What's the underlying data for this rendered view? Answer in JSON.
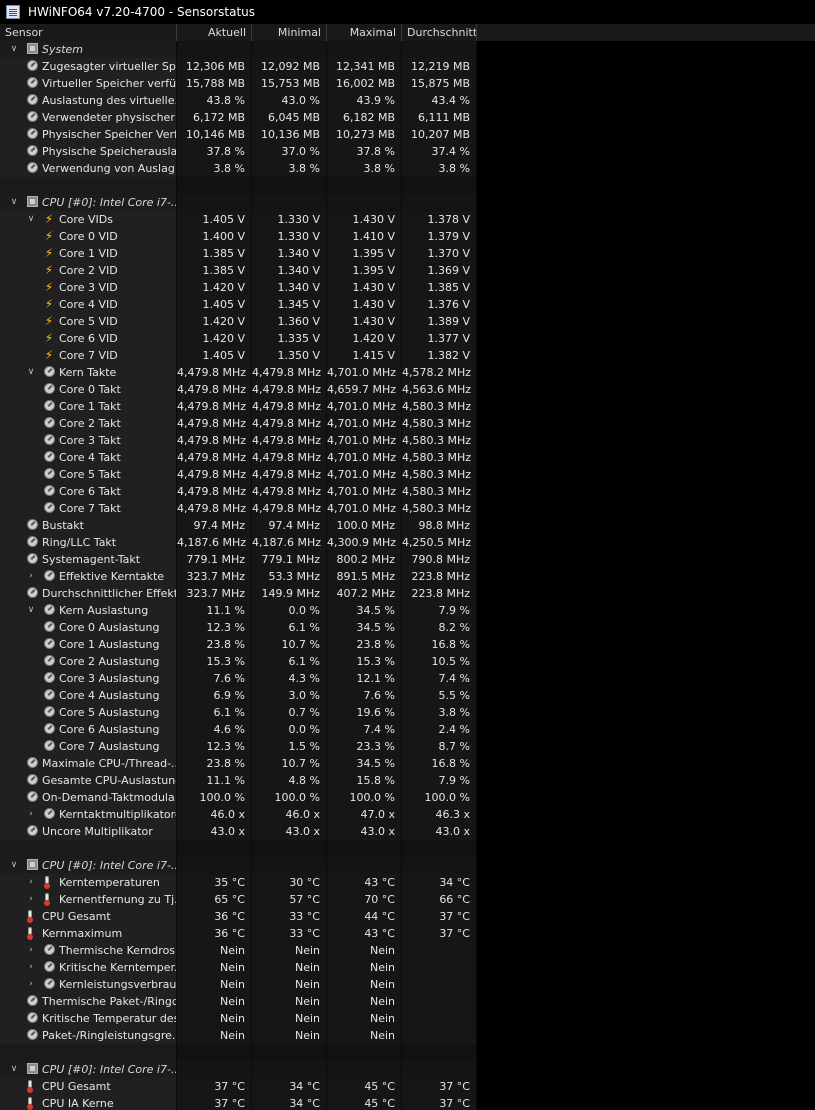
{
  "window": {
    "title": "HWiNFO64 v7.20-4700 - Sensorstatus"
  },
  "columns": [
    "Sensor",
    "Aktuell",
    "Minimal",
    "Maximal",
    "Durchschnitt"
  ],
  "rows": [
    {
      "t": "group",
      "exp": "v",
      "ind": 0,
      "icon": "chip",
      "label": "System"
    },
    {
      "t": "row",
      "exp": "",
      "ind": 1,
      "icon": "dial",
      "label": "Zugesagter virtueller Sp...",
      "v": [
        "12,306 MB",
        "12,092 MB",
        "12,341 MB",
        "12,219 MB"
      ]
    },
    {
      "t": "row",
      "exp": "",
      "ind": 1,
      "icon": "dial",
      "label": "Virtueller Speicher verfü...",
      "v": [
        "15,788 MB",
        "15,753 MB",
        "16,002 MB",
        "15,875 MB"
      ]
    },
    {
      "t": "row",
      "exp": "",
      "ind": 1,
      "icon": "dial",
      "label": "Auslastung des virtuelle...",
      "v": [
        "43.8 %",
        "43.0 %",
        "43.9 %",
        "43.4 %"
      ]
    },
    {
      "t": "row",
      "exp": "",
      "ind": 1,
      "icon": "dial",
      "label": "Verwendeter physischer ...",
      "v": [
        "6,172 MB",
        "6,045 MB",
        "6,182 MB",
        "6,111 MB"
      ]
    },
    {
      "t": "row",
      "exp": "",
      "ind": 1,
      "icon": "dial",
      "label": "Physischer Speicher Verf...",
      "v": [
        "10,146 MB",
        "10,136 MB",
        "10,273 MB",
        "10,207 MB"
      ]
    },
    {
      "t": "row",
      "exp": "",
      "ind": 1,
      "icon": "dial",
      "label": "Physische Speicherausla...",
      "v": [
        "37.8 %",
        "37.0 %",
        "37.8 %",
        "37.4 %"
      ]
    },
    {
      "t": "row",
      "exp": "",
      "ind": 1,
      "icon": "dial",
      "label": "Verwendung von Auslag...",
      "v": [
        "3.8 %",
        "3.8 %",
        "3.8 %",
        "3.8 %"
      ]
    },
    {
      "t": "empty"
    },
    {
      "t": "group",
      "exp": "v",
      "ind": 0,
      "icon": "chip",
      "label": "CPU [#0]: Intel Core i7-..."
    },
    {
      "t": "row",
      "exp": "v",
      "ind": 2,
      "icon": "bolt",
      "label": "Core VIDs",
      "v": [
        "1.405 V",
        "1.330 V",
        "1.430 V",
        "1.378 V"
      ]
    },
    {
      "t": "row",
      "exp": "",
      "ind": 2,
      "icon": "bolt",
      "label": "Core 0 VID",
      "v": [
        "1.400 V",
        "1.330 V",
        "1.410 V",
        "1.379 V"
      ]
    },
    {
      "t": "row",
      "exp": "",
      "ind": 2,
      "icon": "bolt",
      "label": "Core 1 VID",
      "v": [
        "1.385 V",
        "1.340 V",
        "1.395 V",
        "1.370 V"
      ]
    },
    {
      "t": "row",
      "exp": "",
      "ind": 2,
      "icon": "bolt",
      "label": "Core 2 VID",
      "v": [
        "1.385 V",
        "1.340 V",
        "1.395 V",
        "1.369 V"
      ]
    },
    {
      "t": "row",
      "exp": "",
      "ind": 2,
      "icon": "bolt",
      "label": "Core 3 VID",
      "v": [
        "1.420 V",
        "1.340 V",
        "1.430 V",
        "1.385 V"
      ]
    },
    {
      "t": "row",
      "exp": "",
      "ind": 2,
      "icon": "bolt",
      "label": "Core 4 VID",
      "v": [
        "1.405 V",
        "1.345 V",
        "1.430 V",
        "1.376 V"
      ]
    },
    {
      "t": "row",
      "exp": "",
      "ind": 2,
      "icon": "bolt",
      "label": "Core 5 VID",
      "v": [
        "1.420 V",
        "1.360 V",
        "1.430 V",
        "1.389 V"
      ]
    },
    {
      "t": "row",
      "exp": "",
      "ind": 2,
      "icon": "bolt",
      "label": "Core 6 VID",
      "v": [
        "1.420 V",
        "1.335 V",
        "1.420 V",
        "1.377 V"
      ]
    },
    {
      "t": "row",
      "exp": "",
      "ind": 2,
      "icon": "bolt",
      "label": "Core 7 VID",
      "v": [
        "1.405 V",
        "1.350 V",
        "1.415 V",
        "1.382 V"
      ]
    },
    {
      "t": "row",
      "exp": "v",
      "ind": 2,
      "icon": "dial",
      "label": "Kern Takte",
      "v": [
        "4,479.8 MHz",
        "4,479.8 MHz",
        "4,701.0 MHz",
        "4,578.2 MHz"
      ]
    },
    {
      "t": "row",
      "exp": "",
      "ind": 2,
      "icon": "dial",
      "label": "Core 0 Takt",
      "v": [
        "4,479.8 MHz",
        "4,479.8 MHz",
        "4,659.7 MHz",
        "4,563.6 MHz"
      ]
    },
    {
      "t": "row",
      "exp": "",
      "ind": 2,
      "icon": "dial",
      "label": "Core 1 Takt",
      "v": [
        "4,479.8 MHz",
        "4,479.8 MHz",
        "4,701.0 MHz",
        "4,580.3 MHz"
      ]
    },
    {
      "t": "row",
      "exp": "",
      "ind": 2,
      "icon": "dial",
      "label": "Core 2 Takt",
      "v": [
        "4,479.8 MHz",
        "4,479.8 MHz",
        "4,701.0 MHz",
        "4,580.3 MHz"
      ]
    },
    {
      "t": "row",
      "exp": "",
      "ind": 2,
      "icon": "dial",
      "label": "Core 3 Takt",
      "v": [
        "4,479.8 MHz",
        "4,479.8 MHz",
        "4,701.0 MHz",
        "4,580.3 MHz"
      ]
    },
    {
      "t": "row",
      "exp": "",
      "ind": 2,
      "icon": "dial",
      "label": "Core 4 Takt",
      "v": [
        "4,479.8 MHz",
        "4,479.8 MHz",
        "4,701.0 MHz",
        "4,580.3 MHz"
      ]
    },
    {
      "t": "row",
      "exp": "",
      "ind": 2,
      "icon": "dial",
      "label": "Core 5 Takt",
      "v": [
        "4,479.8 MHz",
        "4,479.8 MHz",
        "4,701.0 MHz",
        "4,580.3 MHz"
      ]
    },
    {
      "t": "row",
      "exp": "",
      "ind": 2,
      "icon": "dial",
      "label": "Core 6 Takt",
      "v": [
        "4,479.8 MHz",
        "4,479.8 MHz",
        "4,701.0 MHz",
        "4,580.3 MHz"
      ]
    },
    {
      "t": "row",
      "exp": "",
      "ind": 2,
      "icon": "dial",
      "label": "Core 7 Takt",
      "v": [
        "4,479.8 MHz",
        "4,479.8 MHz",
        "4,701.0 MHz",
        "4,580.3 MHz"
      ]
    },
    {
      "t": "row",
      "exp": "",
      "ind": 1,
      "icon": "dial",
      "label": "Bustakt",
      "v": [
        "97.4 MHz",
        "97.4 MHz",
        "100.0 MHz",
        "98.8 MHz"
      ]
    },
    {
      "t": "row",
      "exp": "",
      "ind": 1,
      "icon": "dial",
      "label": "Ring/LLC Takt",
      "v": [
        "4,187.6 MHz",
        "4,187.6 MHz",
        "4,300.9 MHz",
        "4,250.5 MHz"
      ]
    },
    {
      "t": "row",
      "exp": "",
      "ind": 1,
      "icon": "dial",
      "label": "Systemagent-Takt",
      "v": [
        "779.1 MHz",
        "779.1 MHz",
        "800.2 MHz",
        "790.8 MHz"
      ]
    },
    {
      "t": "row",
      "exp": ">",
      "ind": 2,
      "icon": "dial",
      "label": "Effektive Kerntakte",
      "v": [
        "323.7 MHz",
        "53.3 MHz",
        "891.5 MHz",
        "223.8 MHz"
      ]
    },
    {
      "t": "row",
      "exp": "",
      "ind": 1,
      "icon": "dial",
      "label": "Durchschnittlicher Effekti...",
      "v": [
        "323.7 MHz",
        "149.9 MHz",
        "407.2 MHz",
        "223.8 MHz"
      ]
    },
    {
      "t": "row",
      "exp": "v",
      "ind": 2,
      "icon": "dial",
      "label": "Kern Auslastung",
      "v": [
        "11.1 %",
        "0.0 %",
        "34.5 %",
        "7.9 %"
      ]
    },
    {
      "t": "row",
      "exp": "",
      "ind": 2,
      "icon": "dial",
      "label": "Core 0 Auslastung",
      "v": [
        "12.3 %",
        "6.1 %",
        "34.5 %",
        "8.2 %"
      ]
    },
    {
      "t": "row",
      "exp": "",
      "ind": 2,
      "icon": "dial",
      "label": "Core 1 Auslastung",
      "v": [
        "23.8 %",
        "10.7 %",
        "23.8 %",
        "16.8 %"
      ]
    },
    {
      "t": "row",
      "exp": "",
      "ind": 2,
      "icon": "dial",
      "label": "Core 2 Auslastung",
      "v": [
        "15.3 %",
        "6.1 %",
        "15.3 %",
        "10.5 %"
      ]
    },
    {
      "t": "row",
      "exp": "",
      "ind": 2,
      "icon": "dial",
      "label": "Core 3 Auslastung",
      "v": [
        "7.6 %",
        "4.3 %",
        "12.1 %",
        "7.4 %"
      ]
    },
    {
      "t": "row",
      "exp": "",
      "ind": 2,
      "icon": "dial",
      "label": "Core 4 Auslastung",
      "v": [
        "6.9 %",
        "3.0 %",
        "7.6 %",
        "5.5 %"
      ]
    },
    {
      "t": "row",
      "exp": "",
      "ind": 2,
      "icon": "dial",
      "label": "Core 5 Auslastung",
      "v": [
        "6.1 %",
        "0.7 %",
        "19.6 %",
        "3.8 %"
      ]
    },
    {
      "t": "row",
      "exp": "",
      "ind": 2,
      "icon": "dial",
      "label": "Core 6 Auslastung",
      "v": [
        "4.6 %",
        "0.0 %",
        "7.4 %",
        "2.4 %"
      ]
    },
    {
      "t": "row",
      "exp": "",
      "ind": 2,
      "icon": "dial",
      "label": "Core 7 Auslastung",
      "v": [
        "12.3 %",
        "1.5 %",
        "23.3 %",
        "8.7 %"
      ]
    },
    {
      "t": "row",
      "exp": "",
      "ind": 1,
      "icon": "dial",
      "label": "Maximale CPU-/Thread-...",
      "v": [
        "23.8 %",
        "10.7 %",
        "34.5 %",
        "16.8 %"
      ]
    },
    {
      "t": "row",
      "exp": "",
      "ind": 1,
      "icon": "dial",
      "label": "Gesamte CPU-Auslastung",
      "v": [
        "11.1 %",
        "4.8 %",
        "15.8 %",
        "7.9 %"
      ]
    },
    {
      "t": "row",
      "exp": "",
      "ind": 1,
      "icon": "dial",
      "label": "On-Demand-Taktmodula...",
      "v": [
        "100.0 %",
        "100.0 %",
        "100.0 %",
        "100.0 %"
      ]
    },
    {
      "t": "row",
      "exp": ">",
      "ind": 2,
      "icon": "dial",
      "label": "Kerntaktmultiplikatoren",
      "v": [
        "46.0 x",
        "46.0 x",
        "47.0 x",
        "46.3 x"
      ]
    },
    {
      "t": "row",
      "exp": "",
      "ind": 1,
      "icon": "dial",
      "label": "Uncore Multiplikator",
      "v": [
        "43.0 x",
        "43.0 x",
        "43.0 x",
        "43.0 x"
      ]
    },
    {
      "t": "empty"
    },
    {
      "t": "group",
      "exp": "v",
      "ind": 0,
      "icon": "chip",
      "label": "CPU [#0]: Intel Core i7-..."
    },
    {
      "t": "row",
      "exp": ">",
      "ind": 2,
      "icon": "therm",
      "label": "Kerntemperaturen",
      "v": [
        "35 °C",
        "30 °C",
        "43 °C",
        "34 °C"
      ]
    },
    {
      "t": "row",
      "exp": ">",
      "ind": 2,
      "icon": "therm",
      "label": "Kernentfernung zu Tj...",
      "v": [
        "65 °C",
        "57 °C",
        "70 °C",
        "66 °C"
      ]
    },
    {
      "t": "row",
      "exp": "",
      "ind": 1,
      "icon": "therm",
      "label": "CPU Gesamt",
      "v": [
        "36 °C",
        "33 °C",
        "44 °C",
        "37 °C"
      ]
    },
    {
      "t": "row",
      "exp": "",
      "ind": 1,
      "icon": "therm",
      "label": "Kernmaximum",
      "v": [
        "36 °C",
        "33 °C",
        "43 °C",
        "37 °C"
      ]
    },
    {
      "t": "row",
      "exp": ">",
      "ind": 2,
      "icon": "dial",
      "label": "Thermische Kerndros...",
      "v": [
        "Nein",
        "Nein",
        "Nein",
        ""
      ]
    },
    {
      "t": "row",
      "exp": ">",
      "ind": 2,
      "icon": "dial",
      "label": "Kritische Kerntemper...",
      "v": [
        "Nein",
        "Nein",
        "Nein",
        ""
      ]
    },
    {
      "t": "row",
      "exp": ">",
      "ind": 2,
      "icon": "dial",
      "label": "Kernleistungsverbrau...",
      "v": [
        "Nein",
        "Nein",
        "Nein",
        ""
      ]
    },
    {
      "t": "row",
      "exp": "",
      "ind": 1,
      "icon": "dial",
      "label": "Thermische Paket-/Ringd...",
      "v": [
        "Nein",
        "Nein",
        "Nein",
        ""
      ]
    },
    {
      "t": "row",
      "exp": "",
      "ind": 1,
      "icon": "dial",
      "label": "Kritische Temperatur des...",
      "v": [
        "Nein",
        "Nein",
        "Nein",
        ""
      ]
    },
    {
      "t": "row",
      "exp": "",
      "ind": 1,
      "icon": "dial",
      "label": "Paket-/Ringleistungsgre...",
      "v": [
        "Nein",
        "Nein",
        "Nein",
        ""
      ]
    },
    {
      "t": "empty"
    },
    {
      "t": "group",
      "exp": "v",
      "ind": 0,
      "icon": "chip",
      "label": "CPU [#0]: Intel Core i7-..."
    },
    {
      "t": "row",
      "exp": "",
      "ind": 1,
      "icon": "therm",
      "label": "CPU Gesamt",
      "v": [
        "37 °C",
        "34 °C",
        "45 °C",
        "37 °C"
      ]
    },
    {
      "t": "row",
      "exp": "",
      "ind": 1,
      "icon": "therm",
      "label": "CPU IA Kerne",
      "v": [
        "37 °C",
        "34 °C",
        "45 °C",
        "37 °C"
      ]
    }
  ]
}
